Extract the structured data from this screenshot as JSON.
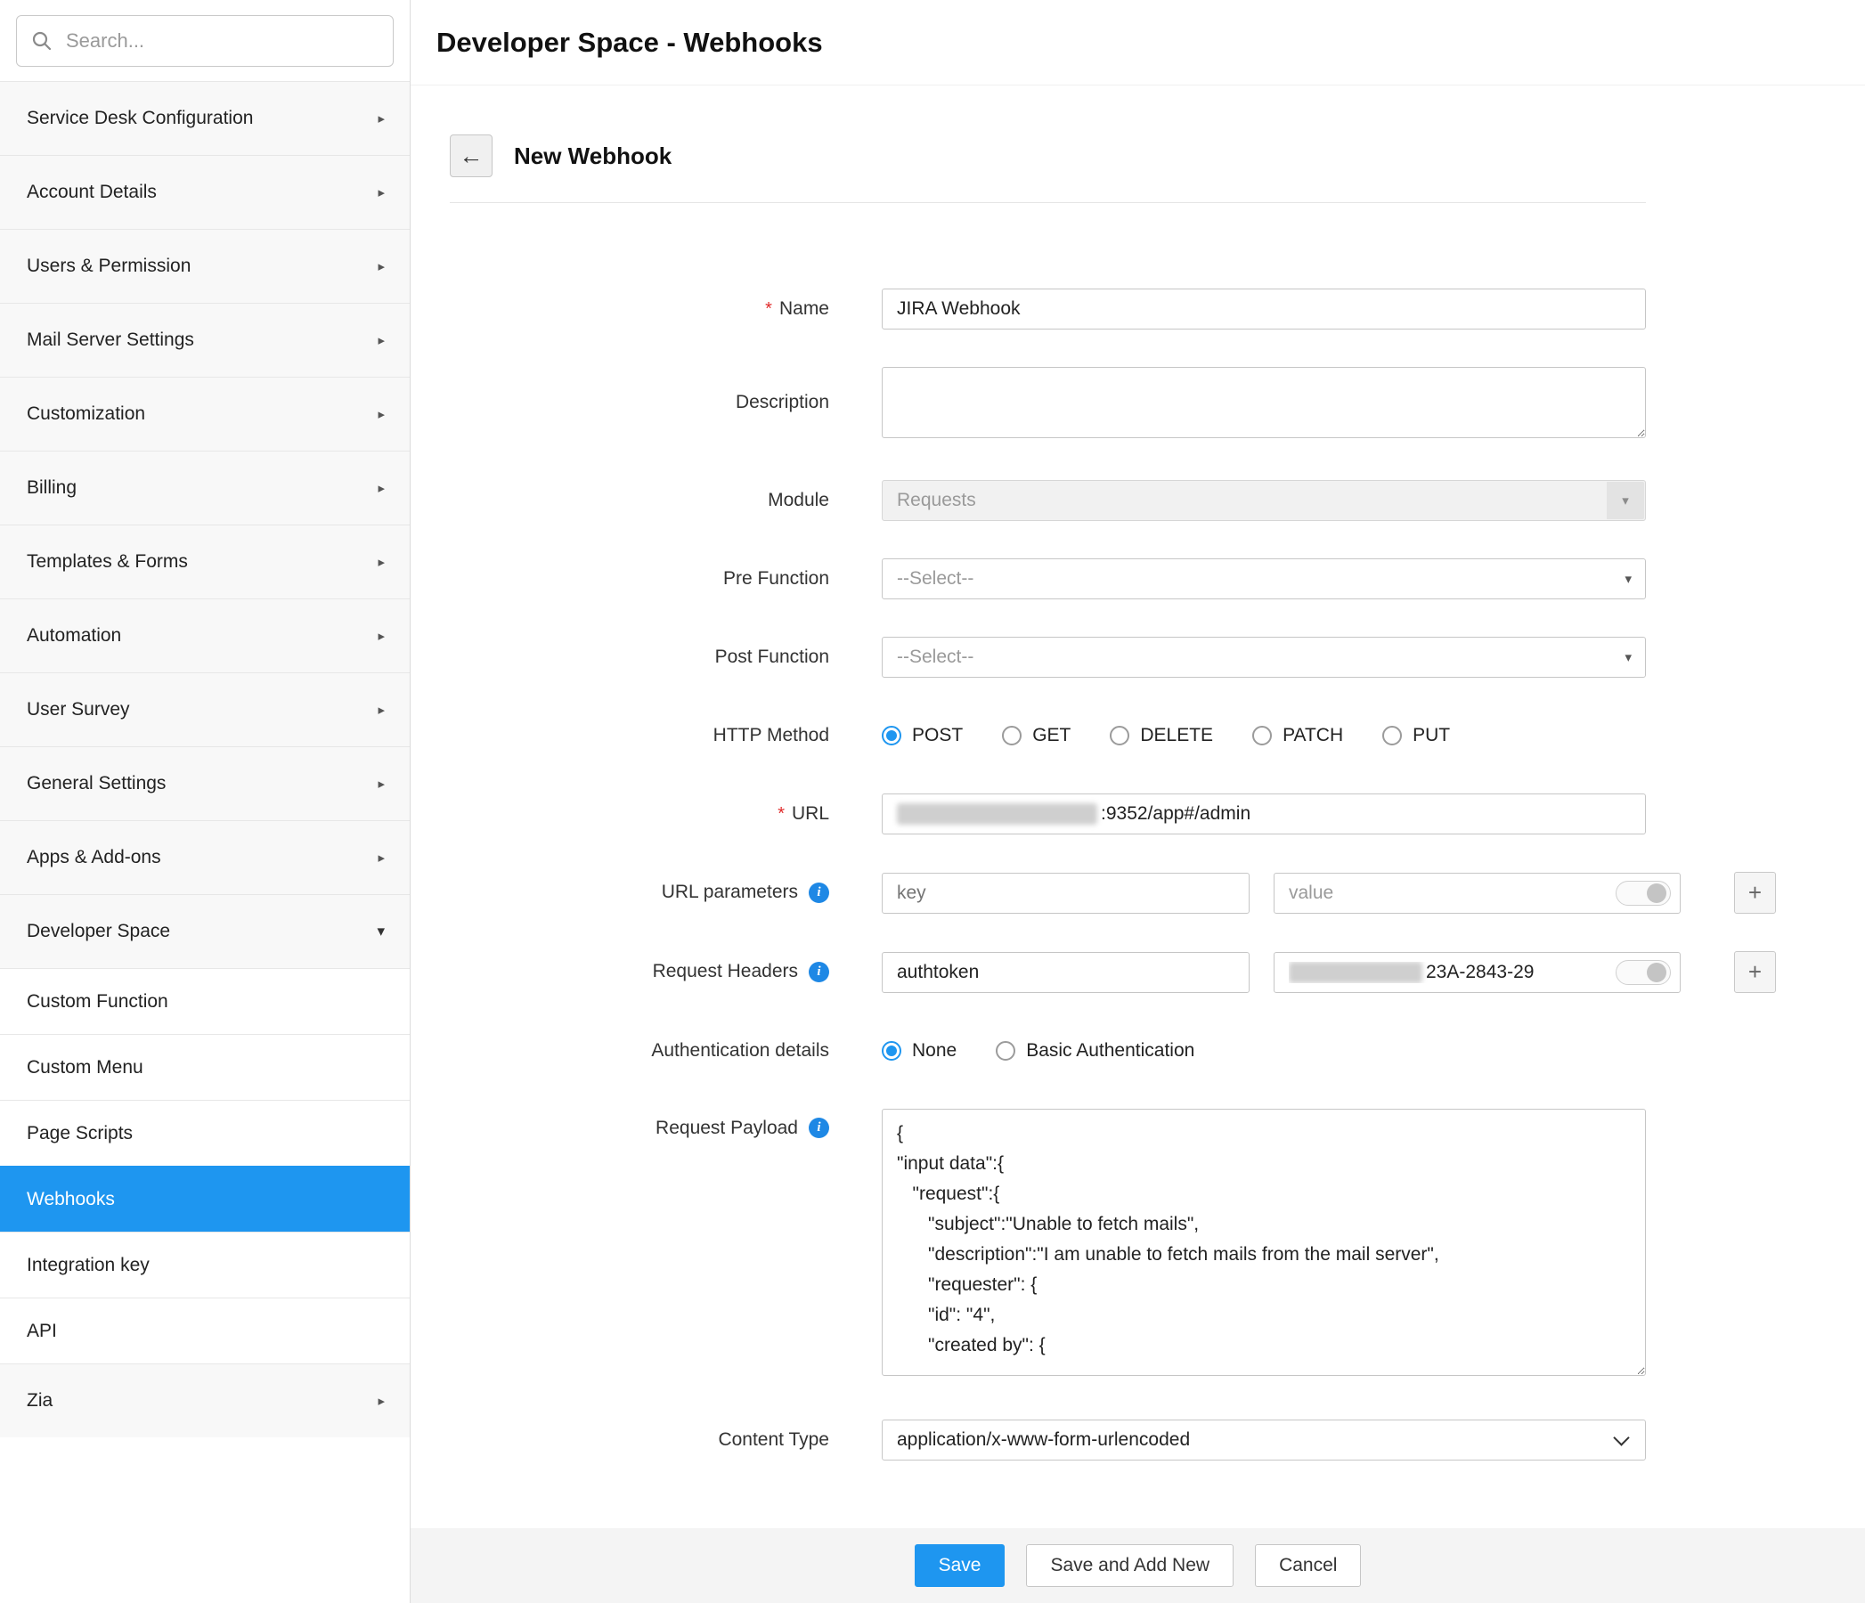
{
  "colors": {
    "accent": "#1e96f0",
    "save_button": "#1e96f0",
    "required_star": "#e02b2b",
    "info_icon": "#1e88e5",
    "sidebar_active_bg": "#1e96f0"
  },
  "icons": {
    "chevron_right": "▸",
    "chevron_down": "▾",
    "caret_down": "▾",
    "back_arrow": "←",
    "info": "i",
    "plus": "+"
  },
  "sidebar": {
    "search_placeholder": "Search...",
    "items": [
      {
        "label": "Service Desk Configuration"
      },
      {
        "label": "Account Details"
      },
      {
        "label": "Users & Permission"
      },
      {
        "label": "Mail Server Settings"
      },
      {
        "label": "Customization"
      },
      {
        "label": "Billing"
      },
      {
        "label": "Templates & Forms"
      },
      {
        "label": "Automation"
      },
      {
        "label": "User Survey"
      },
      {
        "label": "General Settings"
      },
      {
        "label": "Apps & Add-ons"
      },
      {
        "label": "Developer Space"
      },
      {
        "label": "Custom Function"
      },
      {
        "label": "Custom Menu"
      },
      {
        "label": "Page Scripts"
      },
      {
        "label": "Webhooks"
      },
      {
        "label": "Integration key"
      },
      {
        "label": "API"
      },
      {
        "label": "Zia"
      }
    ],
    "active_item": "Webhooks"
  },
  "header": {
    "title": "Developer Space - Webhooks"
  },
  "form": {
    "title": "New Webhook",
    "name": {
      "label": "Name",
      "required": "*",
      "value": "JIRA Webhook"
    },
    "description": {
      "label": "Description",
      "value": ""
    },
    "module": {
      "label": "Module",
      "value": "Requests"
    },
    "pre_function": {
      "label": "Pre Function",
      "value": "--Select--"
    },
    "post_function": {
      "label": "Post Function",
      "value": "--Select--"
    },
    "http_method": {
      "label": "HTTP Method",
      "options": [
        "POST",
        "GET",
        "DELETE",
        "PATCH",
        "PUT"
      ],
      "selected": "POST"
    },
    "url": {
      "label": "URL",
      "required": "*",
      "visible_value": ":9352/app#/admin"
    },
    "url_parameters": {
      "label": "URL parameters",
      "key_placeholder": "key",
      "value_placeholder": "value"
    },
    "request_headers": {
      "label": "Request Headers",
      "key_value": "authtoken",
      "value_visible": "23A-2843-29"
    },
    "authentication": {
      "label": "Authentication details",
      "options": [
        "None",
        "Basic Authentication"
      ],
      "selected": "None"
    },
    "request_payload": {
      "label": "Request Payload",
      "value": "{\n\"input data\":{\n   \"request\":{\n      \"subject\":\"Unable to fetch mails\",\n      \"description\":\"I am unable to fetch mails from the mail server\",\n      \"requester\": {\n      \"id\": \"4\",\n      \"created by\": {"
    },
    "content_type": {
      "label": "Content Type",
      "value": "application/x-www-form-urlencoded"
    }
  },
  "footer": {
    "save": "Save",
    "save_and_add_new": "Save and Add New",
    "cancel": "Cancel"
  }
}
